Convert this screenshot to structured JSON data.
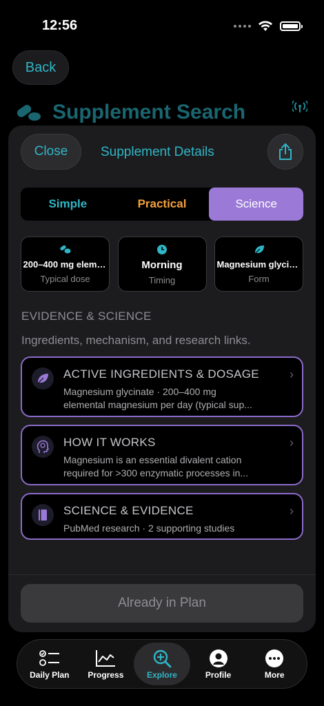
{
  "status": {
    "time": "12:56"
  },
  "nav": {
    "back_label": "Back",
    "page_title": "Supplement Search"
  },
  "sheet": {
    "close_label": "Close",
    "title": "Supplement Details",
    "tabs": [
      {
        "label": "Simple",
        "color": "#2fb6c6"
      },
      {
        "label": "Practical",
        "color": "#f5a23a"
      },
      {
        "label": "Science",
        "color": "#9a7ad6",
        "selected": true
      }
    ],
    "cards": [
      {
        "icon": "pills-icon",
        "value": "200–400 mg eleme...",
        "label": "Typical dose"
      },
      {
        "icon": "clock-icon",
        "value": "Morning",
        "label": "Timing"
      },
      {
        "icon": "leaf-icon",
        "value": "Magnesium glycina...",
        "label": "Form"
      }
    ],
    "section_heading": "EVIDENCE & SCIENCE",
    "section_subtitle": "Ingredients, mechanism, and research links.",
    "rows": [
      {
        "icon": "leaf-icon",
        "title": "ACTIVE INGREDIENTS & DOSAGE",
        "line1": "Magnesium glycinate · 200–400 mg",
        "line2": "elemental magnesium per day (typical sup..."
      },
      {
        "icon": "brain-icon",
        "title": "HOW IT WORKS",
        "line1": "Magnesium is an essential divalent cation",
        "line2": "required for >300 enzymatic processes in..."
      },
      {
        "icon": "book-icon",
        "title": "SCIENCE & EVIDENCE",
        "line1": "PubMed research · 2 supporting studies"
      }
    ],
    "plan_button_label": "Already in Plan"
  },
  "tabbar": {
    "items": [
      {
        "label": "Daily Plan",
        "icon": "checklist-icon"
      },
      {
        "label": "Progress",
        "icon": "chart-icon"
      },
      {
        "label": "Explore",
        "icon": "search-plus-icon",
        "active": true
      },
      {
        "label": "Profile",
        "icon": "person-icon"
      },
      {
        "label": "More",
        "icon": "more-icon"
      }
    ]
  },
  "colors": {
    "accent": "#2fb6c6",
    "science": "#9a7ad6",
    "practical": "#f5a23a"
  }
}
